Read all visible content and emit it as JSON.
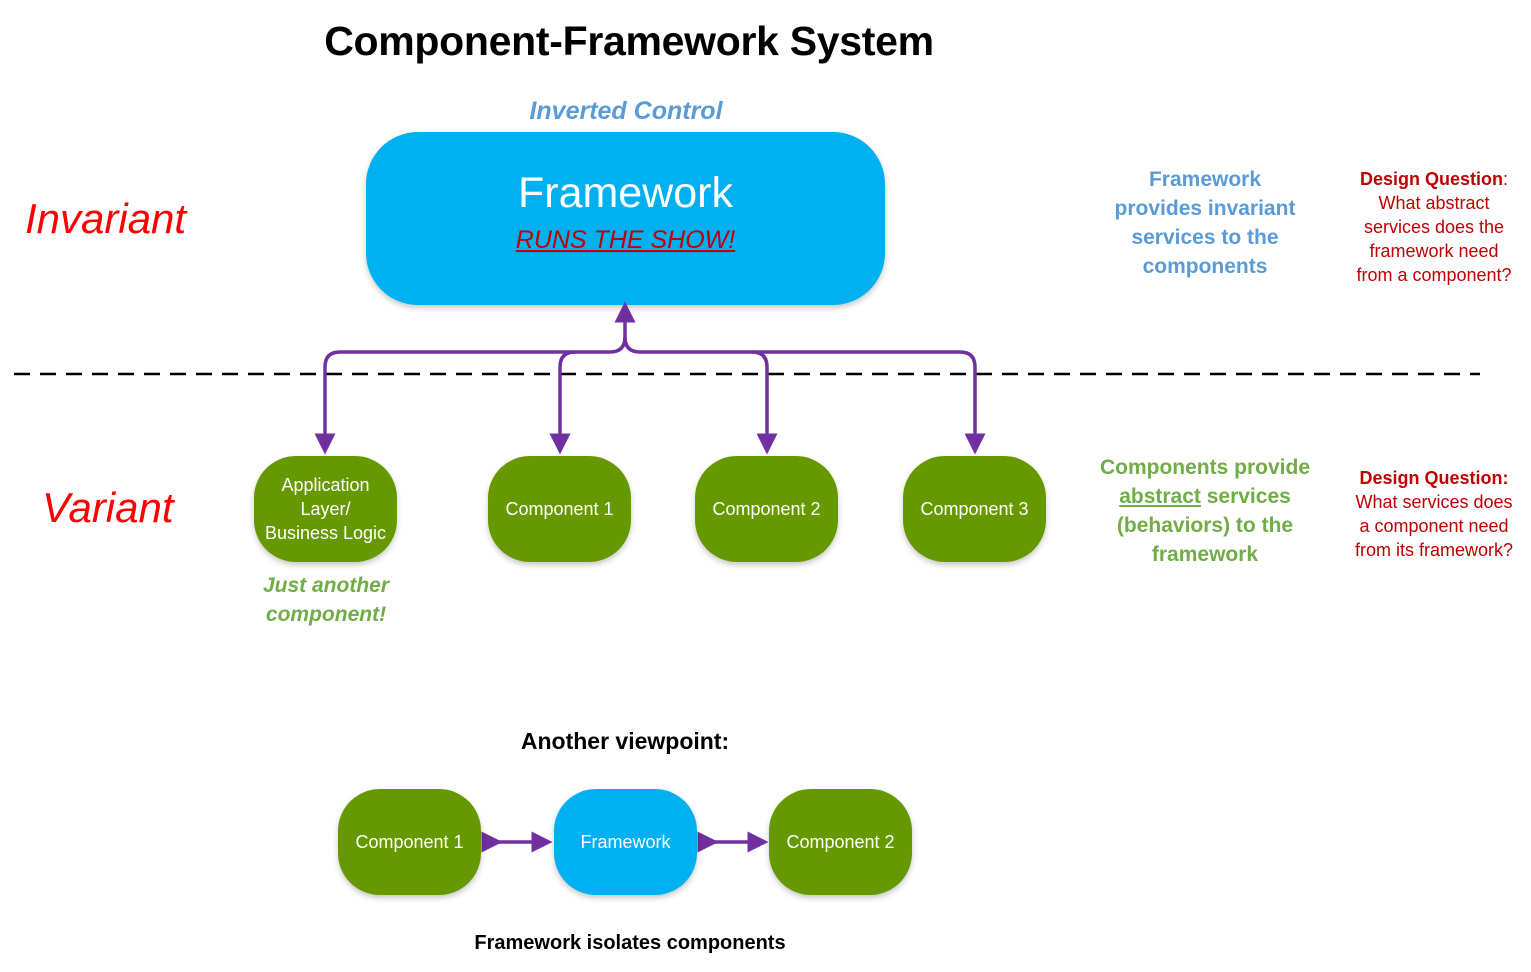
{
  "title": "Component-Framework System",
  "colors": {
    "framework_blue": "#00b0f0",
    "component_green": "#669900",
    "arrow_purple": "#7030a0",
    "invariant_red": "#ff0000",
    "question_red": "#c00000",
    "note_blue": "#5b9bd5",
    "note_green": "#70ad47"
  },
  "top": {
    "inverted_control": "Inverted Control",
    "framework": {
      "name": "Framework",
      "tagline": "RUNS THE SHOW!"
    }
  },
  "side_labels": {
    "invariant": "Invariant",
    "variant": "Variant"
  },
  "components": [
    {
      "lines": [
        "Application",
        "Layer/",
        "Business Logic"
      ]
    },
    {
      "lines": [
        "Component 1"
      ]
    },
    {
      "lines": [
        "Component 2"
      ]
    },
    {
      "lines": [
        "Component 3"
      ]
    }
  ],
  "app_caption": [
    "Just another",
    "component!"
  ],
  "notes": {
    "framework_note": [
      "Framework",
      "provides invariant",
      "services to the",
      "components"
    ],
    "component_note": {
      "line1": "Components provide",
      "line2_underlined": "abstract",
      "line2_rest": " services",
      "line3": "(behaviors) to the",
      "line4": "framework"
    }
  },
  "design_questions": [
    {
      "heading": "Design Question",
      "heading_suffix": ":",
      "lines": [
        "What abstract",
        "services does the",
        "framework need",
        "from a component?"
      ]
    },
    {
      "heading": "Design Question:",
      "heading_suffix": "",
      "lines": [
        "What services does",
        "a component need",
        "from its framework?"
      ]
    }
  ],
  "alt_view": {
    "heading": "Another viewpoint:",
    "left": "Component 1",
    "center": "Framework",
    "right": "Component 2",
    "caption": "Framework isolates components"
  }
}
